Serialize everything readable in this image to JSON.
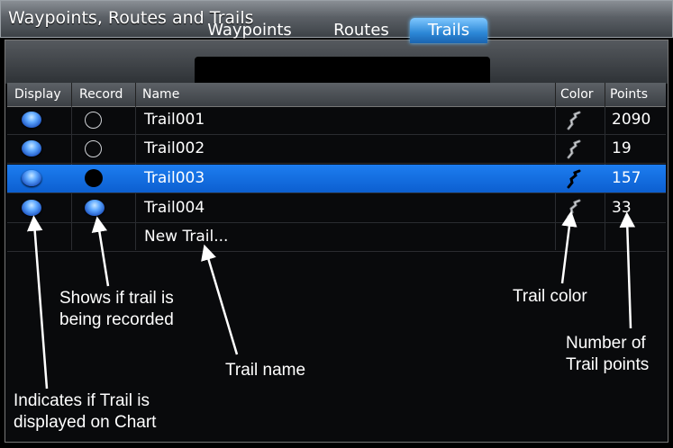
{
  "window": {
    "title": "Waypoints, Routes and Trails"
  },
  "tabs": [
    {
      "label": "Waypoints",
      "active": false
    },
    {
      "label": "Routes",
      "active": false
    },
    {
      "label": "Trails",
      "active": true
    }
  ],
  "columns": {
    "display": "Display",
    "record": "Record",
    "name": "Name",
    "color": "Color",
    "points": "Points"
  },
  "rows": [
    {
      "name": "Trail001",
      "points": "2090",
      "display": true,
      "record": false,
      "selected": false
    },
    {
      "name": "Trail002",
      "points": "19",
      "display": true,
      "record": false,
      "selected": false
    },
    {
      "name": "Trail003",
      "points": "157",
      "display": true,
      "record": false,
      "selected": true
    },
    {
      "name": "Trail004",
      "points": "33",
      "display": true,
      "record": true,
      "selected": false
    }
  ],
  "new_trail_label": "New Trail...",
  "annotations": {
    "record": [
      "Shows if trail is",
      "being recorded"
    ],
    "color": "Trail color",
    "name": "Trail name",
    "points": [
      "Number of",
      "Trail points"
    ],
    "display": [
      "Indicates if Trail is",
      "displayed on Chart"
    ]
  },
  "colors": {
    "selected_row": "#1466e0",
    "tab_active": "#2c87d6",
    "icon_color": "trail-color-icon"
  }
}
